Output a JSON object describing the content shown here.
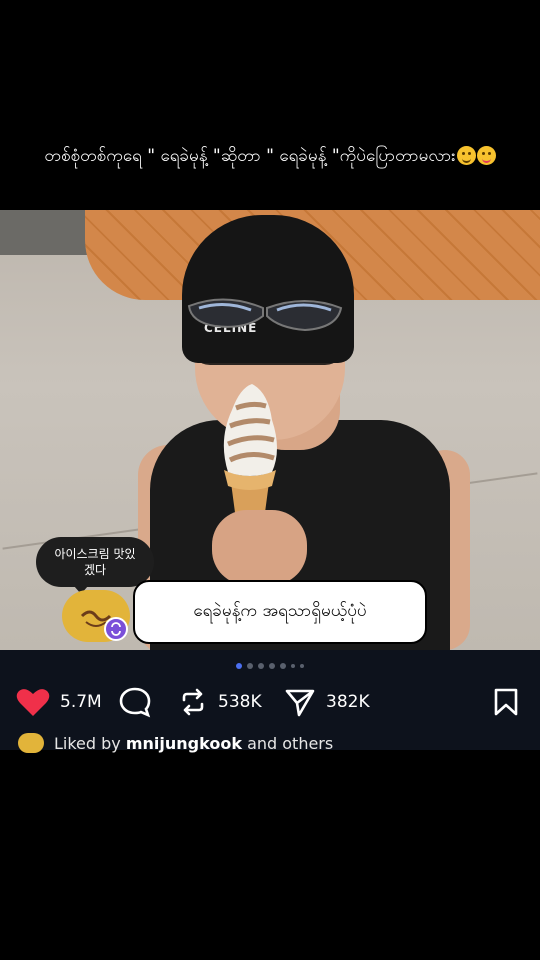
{
  "caption": {
    "text": "တစ်စုံတစ်ကုရေ \" ရေခဲမုန့် \"ဆိုတာ \" ရေခဲမုန့် \"ကိုပဲပြောတာမလား",
    "emoji_1": "winking-face-icon",
    "emoji_2": "tongue-face-icon"
  },
  "photo": {
    "beanie_brand": "CELINE"
  },
  "overlay": {
    "speech_bubble": "아이스크림 맛있\n겠다",
    "comment_text": "ရေခဲမုန့်က အရသာရှိမယ့်ပုံပဲ",
    "avatar_icon": "user-avatar-icon",
    "badge_icon": "repost-badge-icon"
  },
  "carousel": {
    "count": 7,
    "active_index": 0
  },
  "actions": {
    "likes": "5.7M",
    "comments_label": "",
    "reposts": "538K",
    "shares": "382K"
  },
  "liked_by": {
    "prefix": "Liked by",
    "user": "mnijungkook",
    "suffix": "and others"
  },
  "colors": {
    "background": "#000000",
    "action_bar": "#0d121c",
    "like_red": "#f0304a",
    "active_dot": "#4b6ff0"
  }
}
